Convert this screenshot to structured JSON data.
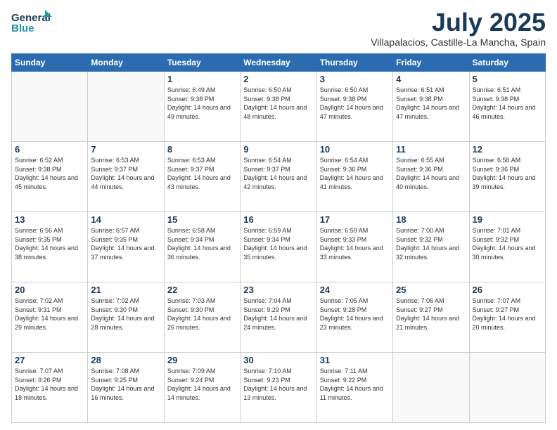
{
  "header": {
    "logo_line1": "General",
    "logo_line2": "Blue",
    "month": "July 2025",
    "location": "Villapalacios, Castille-La Mancha, Spain"
  },
  "weekdays": [
    "Sunday",
    "Monday",
    "Tuesday",
    "Wednesday",
    "Thursday",
    "Friday",
    "Saturday"
  ],
  "weeks": [
    [
      {
        "day": "",
        "info": ""
      },
      {
        "day": "",
        "info": ""
      },
      {
        "day": "1",
        "info": "Sunrise: 6:49 AM\nSunset: 9:38 PM\nDaylight: 14 hours and 49 minutes."
      },
      {
        "day": "2",
        "info": "Sunrise: 6:50 AM\nSunset: 9:38 PM\nDaylight: 14 hours and 48 minutes."
      },
      {
        "day": "3",
        "info": "Sunrise: 6:50 AM\nSunset: 9:38 PM\nDaylight: 14 hours and 47 minutes."
      },
      {
        "day": "4",
        "info": "Sunrise: 6:51 AM\nSunset: 9:38 PM\nDaylight: 14 hours and 47 minutes."
      },
      {
        "day": "5",
        "info": "Sunrise: 6:51 AM\nSunset: 9:38 PM\nDaylight: 14 hours and 46 minutes."
      }
    ],
    [
      {
        "day": "6",
        "info": "Sunrise: 6:52 AM\nSunset: 9:38 PM\nDaylight: 14 hours and 45 minutes."
      },
      {
        "day": "7",
        "info": "Sunrise: 6:53 AM\nSunset: 9:37 PM\nDaylight: 14 hours and 44 minutes."
      },
      {
        "day": "8",
        "info": "Sunrise: 6:53 AM\nSunset: 9:37 PM\nDaylight: 14 hours and 43 minutes."
      },
      {
        "day": "9",
        "info": "Sunrise: 6:54 AM\nSunset: 9:37 PM\nDaylight: 14 hours and 42 minutes."
      },
      {
        "day": "10",
        "info": "Sunrise: 6:54 AM\nSunset: 9:36 PM\nDaylight: 14 hours and 41 minutes."
      },
      {
        "day": "11",
        "info": "Sunrise: 6:55 AM\nSunset: 9:36 PM\nDaylight: 14 hours and 40 minutes."
      },
      {
        "day": "12",
        "info": "Sunrise: 6:56 AM\nSunset: 9:36 PM\nDaylight: 14 hours and 39 minutes."
      }
    ],
    [
      {
        "day": "13",
        "info": "Sunrise: 6:56 AM\nSunset: 9:35 PM\nDaylight: 14 hours and 38 minutes."
      },
      {
        "day": "14",
        "info": "Sunrise: 6:57 AM\nSunset: 9:35 PM\nDaylight: 14 hours and 37 minutes."
      },
      {
        "day": "15",
        "info": "Sunrise: 6:58 AM\nSunset: 9:34 PM\nDaylight: 14 hours and 36 minutes."
      },
      {
        "day": "16",
        "info": "Sunrise: 6:59 AM\nSunset: 9:34 PM\nDaylight: 14 hours and 35 minutes."
      },
      {
        "day": "17",
        "info": "Sunrise: 6:59 AM\nSunset: 9:33 PM\nDaylight: 14 hours and 33 minutes."
      },
      {
        "day": "18",
        "info": "Sunrise: 7:00 AM\nSunset: 9:32 PM\nDaylight: 14 hours and 32 minutes."
      },
      {
        "day": "19",
        "info": "Sunrise: 7:01 AM\nSunset: 9:32 PM\nDaylight: 14 hours and 30 minutes."
      }
    ],
    [
      {
        "day": "20",
        "info": "Sunrise: 7:02 AM\nSunset: 9:31 PM\nDaylight: 14 hours and 29 minutes."
      },
      {
        "day": "21",
        "info": "Sunrise: 7:02 AM\nSunset: 9:30 PM\nDaylight: 14 hours and 28 minutes."
      },
      {
        "day": "22",
        "info": "Sunrise: 7:03 AM\nSunset: 9:30 PM\nDaylight: 14 hours and 26 minutes."
      },
      {
        "day": "23",
        "info": "Sunrise: 7:04 AM\nSunset: 9:29 PM\nDaylight: 14 hours and 24 minutes."
      },
      {
        "day": "24",
        "info": "Sunrise: 7:05 AM\nSunset: 9:28 PM\nDaylight: 14 hours and 23 minutes."
      },
      {
        "day": "25",
        "info": "Sunrise: 7:06 AM\nSunset: 9:27 PM\nDaylight: 14 hours and 21 minutes."
      },
      {
        "day": "26",
        "info": "Sunrise: 7:07 AM\nSunset: 9:27 PM\nDaylight: 14 hours and 20 minutes."
      }
    ],
    [
      {
        "day": "27",
        "info": "Sunrise: 7:07 AM\nSunset: 9:26 PM\nDaylight: 14 hours and 18 minutes."
      },
      {
        "day": "28",
        "info": "Sunrise: 7:08 AM\nSunset: 9:25 PM\nDaylight: 14 hours and 16 minutes."
      },
      {
        "day": "29",
        "info": "Sunrise: 7:09 AM\nSunset: 9:24 PM\nDaylight: 14 hours and 14 minutes."
      },
      {
        "day": "30",
        "info": "Sunrise: 7:10 AM\nSunset: 9:23 PM\nDaylight: 14 hours and 13 minutes."
      },
      {
        "day": "31",
        "info": "Sunrise: 7:11 AM\nSunset: 9:22 PM\nDaylight: 14 hours and 11 minutes."
      },
      {
        "day": "",
        "info": ""
      },
      {
        "day": "",
        "info": ""
      }
    ]
  ]
}
